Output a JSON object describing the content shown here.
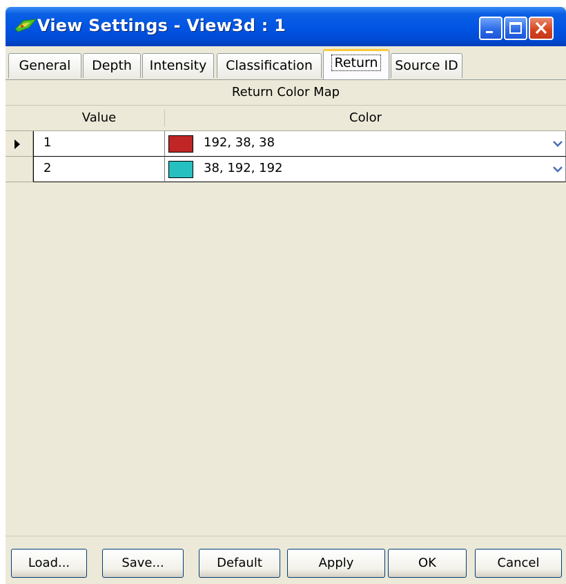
{
  "window": {
    "title": "View Settings - View3d : 1"
  },
  "tabs": [
    {
      "label": "General"
    },
    {
      "label": "Depth"
    },
    {
      "label": "Intensity"
    },
    {
      "label": "Classification"
    },
    {
      "label": "Return",
      "active": true
    },
    {
      "label": "Source ID"
    }
  ],
  "grid": {
    "caption": "Return Color Map",
    "columns": [
      "Value",
      "Color"
    ],
    "rows": [
      {
        "value": "1",
        "color_text": "192, 38, 38",
        "swatch": "#c02626",
        "current": true
      },
      {
        "value": "2",
        "color_text": "38, 192, 192",
        "swatch": "#26c0c0",
        "current": false
      }
    ]
  },
  "buttons": {
    "load": "Load...",
    "save": "Save...",
    "default": "Default",
    "apply": "Apply",
    "ok": "OK",
    "cancel": "Cancel"
  },
  "icons": [
    "app-icon",
    "minimize-icon",
    "maximize-icon",
    "close-icon",
    "row-pointer-icon",
    "dropdown-arrow-icon"
  ]
}
